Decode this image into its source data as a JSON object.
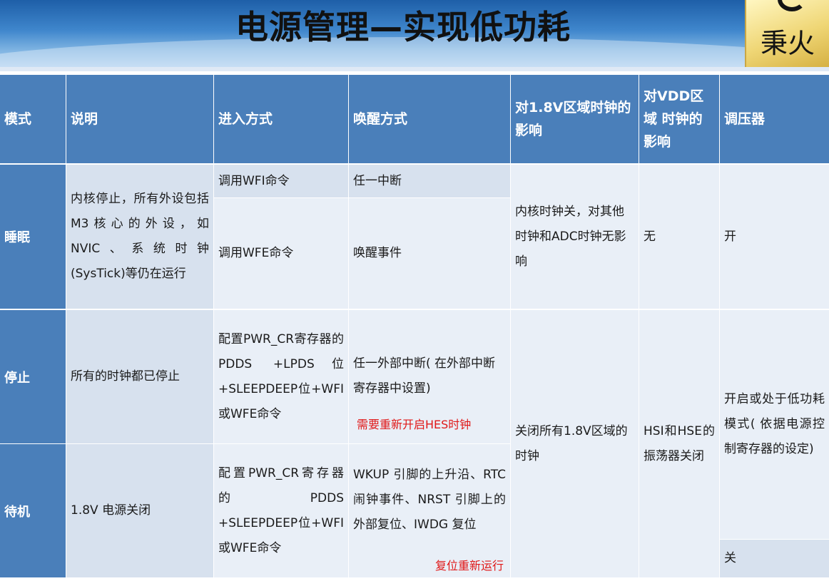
{
  "title": "电源管理—实现低功耗",
  "logo": {
    "text": "秉火"
  },
  "table": {
    "headers": {
      "mode": "模式",
      "desc": "说明",
      "enter": "进入方式",
      "wake": "唤醒方式",
      "clock18": "对1.8V区域时钟的影响",
      "vdd": "对VDD区域 时钟的影响",
      "regulator": "调压器"
    },
    "sleep": {
      "mode": "睡眠",
      "desc": "内核停止，所有外设包括M3核心的外设，如NVIC、系统时钟(SysTick)等仍在运行",
      "enter_wfi": "调用WFI命令",
      "wake_wfi": "任一中断",
      "enter_wfe": "调用WFE命令",
      "wake_wfe": "唤醒事件",
      "clock18": "内核时钟关，对其他时钟和ADC时钟无影响",
      "vdd": "无",
      "regulator": "开"
    },
    "stop": {
      "mode": "停止",
      "desc": "所有的时钟都已停止",
      "enter": "配置PWR_CR寄存器的PDDS +LPDS位+SLEEPDEEP位+WFI或WFE命令",
      "wake": "任一外部中断( 在外部中断寄存器中设置)",
      "note": "需要重新开启HES时钟"
    },
    "standby": {
      "mode": "待机",
      "desc": "1.8V 电源关闭",
      "enter": "配置PWR_CR寄存器 的 PDDS +SLEEPDEEP位+WFI或WFE命令",
      "wake": "WKUP 引脚的上升沿、RTC闹钟事件、NRST 引脚上的外部复位、IWDG 复位",
      "note": "复位重新运行",
      "regulator": "关"
    },
    "stop_standby_shared": {
      "clock18": "关闭所有1.8V区域的时钟",
      "vdd": "HSI和HSE的振荡器关闭",
      "regulator": "开启或处于低功耗模式( 依据电源控制寄存器的设定)"
    }
  },
  "colors": {
    "header_bg": "#4a7fba",
    "cell_bg": "#d7e1ee",
    "cell_alt_bg": "#e9eff7",
    "note_red": "#e01818"
  }
}
